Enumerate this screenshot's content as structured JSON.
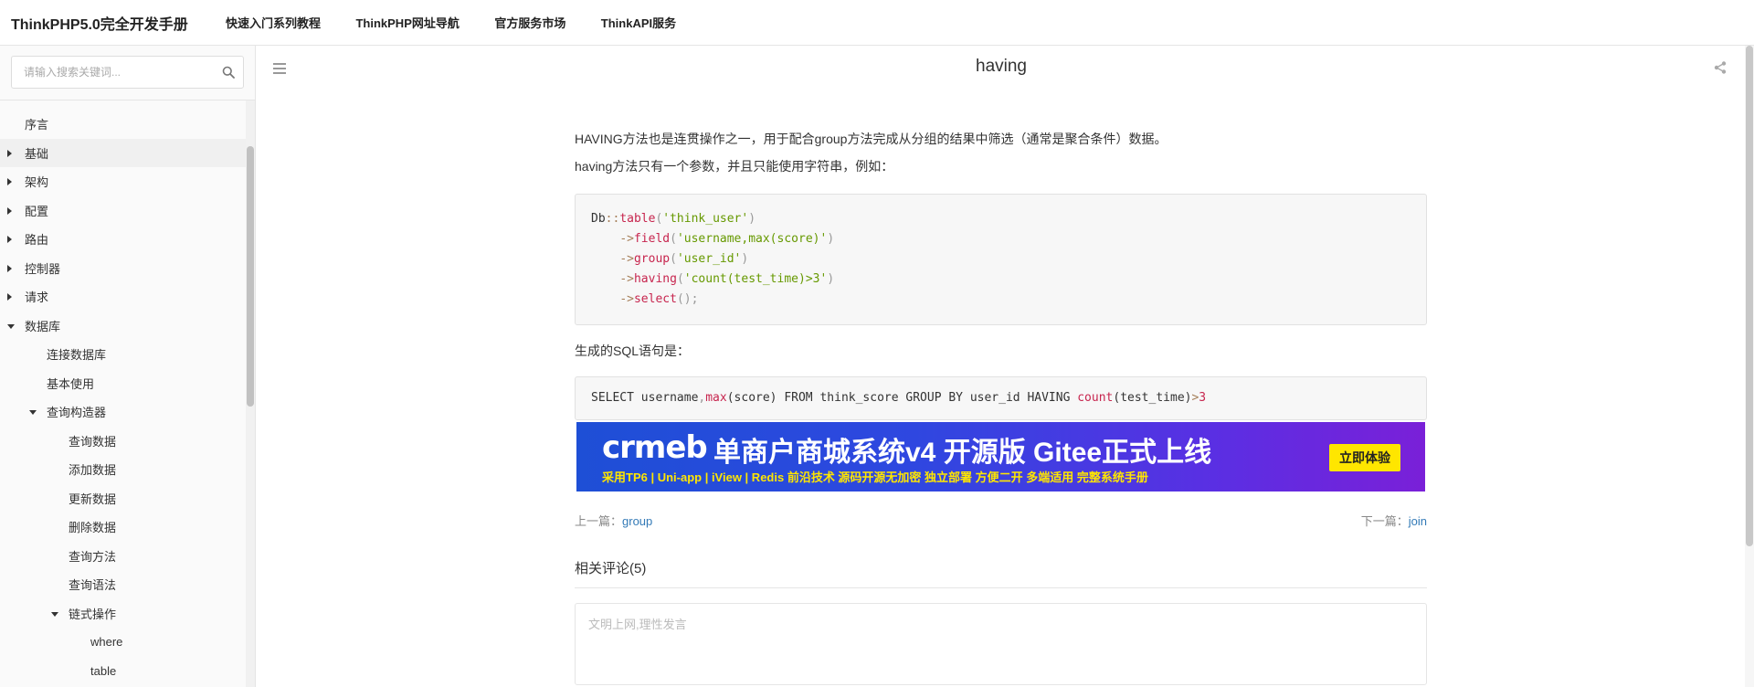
{
  "app": {
    "brand": "ThinkPHP5.0完全开发手册",
    "nav": [
      "快速入门系列教程",
      "ThinkPHP网址导航",
      "官方服务市场",
      "ThinkAPI服务"
    ]
  },
  "sidebar": {
    "search_placeholder": "请输入搜索关键词...",
    "items": [
      {
        "label": "序言",
        "level": 0,
        "caret": "none"
      },
      {
        "label": "基础",
        "level": 0,
        "caret": "right",
        "active": true
      },
      {
        "label": "架构",
        "level": 0,
        "caret": "right"
      },
      {
        "label": "配置",
        "level": 0,
        "caret": "right"
      },
      {
        "label": "路由",
        "level": 0,
        "caret": "right"
      },
      {
        "label": "控制器",
        "level": 0,
        "caret": "right"
      },
      {
        "label": "请求",
        "level": 0,
        "caret": "right"
      },
      {
        "label": "数据库",
        "level": 0,
        "caret": "down"
      },
      {
        "label": "连接数据库",
        "level": 1,
        "caret": "none"
      },
      {
        "label": "基本使用",
        "level": 1,
        "caret": "none"
      },
      {
        "label": "查询构造器",
        "level": 1,
        "caret": "down"
      },
      {
        "label": "查询数据",
        "level": 2,
        "caret": "none"
      },
      {
        "label": "添加数据",
        "level": 2,
        "caret": "none"
      },
      {
        "label": "更新数据",
        "level": 2,
        "caret": "none"
      },
      {
        "label": "删除数据",
        "level": 2,
        "caret": "none"
      },
      {
        "label": "查询方法",
        "level": 2,
        "caret": "none"
      },
      {
        "label": "查询语法",
        "level": 2,
        "caret": "none"
      },
      {
        "label": "链式操作",
        "level": 2,
        "caret": "down"
      },
      {
        "label": "where",
        "level": 3,
        "caret": "none"
      },
      {
        "label": "table",
        "level": 3,
        "caret": "none"
      }
    ]
  },
  "page": {
    "title": "having",
    "para1": "HAVING方法也是连贯操作之一，用于配合group方法完成从分组的结果中筛选（通常是聚合条件）数据。",
    "para2": "having方法只有一个参数，并且只能使用字符串，例如：",
    "code1": {
      "l1_cls": "Db",
      "l1_op": "::",
      "l1_fn": "table",
      "l1_open": "(",
      "l1_str": "'think_user'",
      "l1_close": ")",
      "l2_arrow": "->",
      "l2_fn": "field",
      "l2_open": "(",
      "l2_str": "'username,max(score)'",
      "l2_close": ")",
      "l3_arrow": "->",
      "l3_fn": "group",
      "l3_open": "(",
      "l3_str": "'user_id'",
      "l3_close": ")",
      "l4_arrow": "->",
      "l4_fn": "having",
      "l4_open": "(",
      "l4_str": "'count(test_time)>3'",
      "l4_close": ")",
      "l5_arrow": "->",
      "l5_fn": "select",
      "l5_end": "();"
    },
    "para3": "生成的SQL语句是：",
    "code2": {
      "a": "SELECT username",
      "comma": ",",
      "fn1": "max",
      "b": "(score) FROM think_score GROUP BY user_id HAVING ",
      "fn2": "count",
      "c": "(test_time)",
      "gt": ">",
      "num": "3"
    },
    "banner": {
      "logo": "crmeb",
      "title": "单商户商城系统v4 开源版  Gitee正式上线",
      "subtitle": "采用TP6 | Uni-app | iView |  Redis 前沿技术     源码开源无加密  独立部署  方便二开  多端适用   完整系统手册",
      "button": "立即体验"
    },
    "prev_label": "上一篇：",
    "prev_link": "group",
    "next_label": "下一篇：",
    "next_link": "join",
    "comments_title": "相关评论(5)",
    "comment_placeholder": "文明上网,理性发言"
  }
}
